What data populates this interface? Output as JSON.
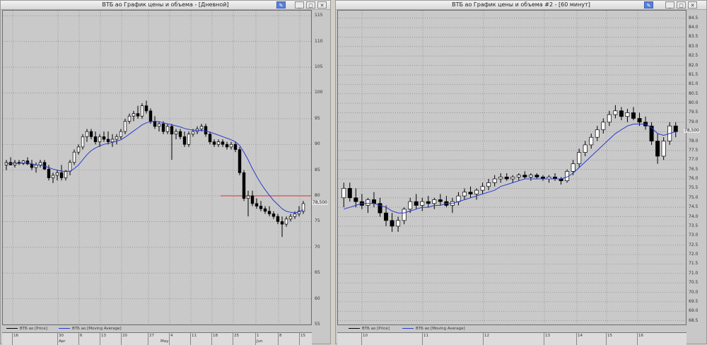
{
  "windows": [
    {
      "title": "ВТБ ао График цены и объема - [Дневной]",
      "buttons": {
        "pin": "✎",
        "minimize": "_",
        "restore": "▢",
        "close": "✕"
      },
      "y_labels": [
        "115",
        "110",
        "105",
        "100",
        "95",
        "90",
        "85",
        "80",
        "75",
        "70",
        "65",
        "60",
        "55"
      ],
      "current_value": "78,500",
      "legend": {
        "price": "ВТБ ао [Price]",
        "ma": "ВТБ ао [Moving Average]"
      },
      "x_days": [
        "16",
        "30",
        "6",
        "13",
        "20",
        "27",
        "4",
        "11",
        "18",
        "25",
        "1",
        "8",
        "15"
      ],
      "x_months": [
        "Apr",
        "May",
        "Jun"
      ],
      "colors": {
        "candle": "#000000",
        "ma": "#2a3bd0",
        "level": "#e03030"
      },
      "chart_data": {
        "type": "candlestick",
        "ylim": [
          55,
          116
        ],
        "level": 80,
        "candles": [
          [
            86,
            87,
            85,
            86.5
          ],
          [
            86.5,
            87.5,
            86,
            86
          ],
          [
            86,
            87,
            85.5,
            86.5
          ],
          [
            86.5,
            87,
            86,
            86.3
          ],
          [
            86.3,
            87,
            86,
            86.8
          ],
          [
            86.8,
            87.5,
            86,
            86.2
          ],
          [
            86.2,
            87,
            85,
            85.5
          ],
          [
            85.5,
            86.5,
            84.5,
            86
          ],
          [
            86,
            87,
            85.5,
            86.5
          ],
          [
            86.5,
            87,
            85,
            85.2
          ],
          [
            85.2,
            86,
            83,
            83.5
          ],
          [
            83.5,
            84.5,
            82.5,
            84
          ],
          [
            84,
            85,
            83,
            84.5
          ],
          [
            84.5,
            86,
            83,
            83.5
          ],
          [
            83.5,
            85,
            83,
            84.8
          ],
          [
            84.8,
            87,
            84,
            86.5
          ],
          [
            86.5,
            89,
            86,
            88.5
          ],
          [
            88.5,
            90,
            88,
            89.5
          ],
          [
            89.5,
            92,
            89,
            91.5
          ],
          [
            91.5,
            93,
            90.5,
            92.5
          ],
          [
            92.5,
            93,
            91,
            91.5
          ],
          [
            91.5,
            92.5,
            90,
            90.5
          ],
          [
            90.5,
            92,
            89.5,
            91.5
          ],
          [
            91.5,
            92.5,
            90.5,
            91
          ],
          [
            91,
            92.5,
            90,
            90.5
          ],
          [
            90.5,
            92,
            89.5,
            91
          ],
          [
            91,
            92,
            90,
            91.5
          ],
          [
            91.5,
            93,
            91,
            92.5
          ],
          [
            92.5,
            95,
            92,
            94.5
          ],
          [
            94.5,
            96,
            94,
            95.5
          ],
          [
            95.5,
            96.5,
            94.5,
            96
          ],
          [
            96,
            97.5,
            95,
            95.5
          ],
          [
            95.5,
            98,
            95,
            97.5
          ],
          [
            97.5,
            98.5,
            96,
            96.5
          ],
          [
            96.5,
            97,
            94,
            94.5
          ],
          [
            94.5,
            95.5,
            93,
            93.5
          ],
          [
            93.5,
            94.5,
            92.5,
            94
          ],
          [
            94,
            94.5,
            92,
            92.5
          ],
          [
            92.5,
            94,
            92,
            93.5
          ],
          [
            93.5,
            94,
            87,
            92
          ],
          [
            92,
            93,
            91,
            92.5
          ],
          [
            92.5,
            93,
            91,
            91.5
          ],
          [
            91.5,
            92.5,
            89.5,
            90
          ],
          [
            90,
            92.5,
            89.5,
            92
          ],
          [
            92,
            93,
            91.5,
            92.5
          ],
          [
            92.5,
            93.5,
            92,
            93
          ],
          [
            93,
            94,
            92.5,
            93.5
          ],
          [
            93.5,
            94,
            91.5,
            92
          ],
          [
            92,
            92.5,
            90,
            90.5
          ],
          [
            90.5,
            91,
            89.5,
            90
          ],
          [
            90,
            91,
            89.5,
            90.5
          ],
          [
            90.5,
            91,
            89.5,
            90
          ],
          [
            90,
            90.5,
            89,
            89.5
          ],
          [
            89.5,
            90.5,
            89,
            90
          ],
          [
            90,
            90.5,
            88.5,
            89
          ],
          [
            89,
            89.5,
            84,
            84.5
          ],
          [
            84.5,
            85,
            79,
            79.5
          ],
          [
            79.5,
            81,
            76,
            80
          ],
          [
            80,
            81,
            78,
            78.5
          ],
          [
            78.5,
            79.5,
            77.5,
            78
          ],
          [
            78,
            79,
            77,
            77.5
          ],
          [
            77.5,
            78,
            76.5,
            77
          ],
          [
            77,
            78,
            76,
            76.5
          ],
          [
            76.5,
            77,
            75.5,
            76
          ],
          [
            76,
            76.5,
            74.5,
            75
          ],
          [
            75,
            76,
            72,
            74.5
          ],
          [
            74.5,
            76,
            74,
            75.5
          ],
          [
            75.5,
            76.5,
            75,
            76
          ],
          [
            76,
            77,
            75.5,
            76.5
          ],
          [
            76.5,
            78,
            76,
            77
          ],
          [
            77,
            79,
            76.5,
            78.5
          ]
        ],
        "ma": [
          86.3,
          86.3,
          86.3,
          86.3,
          86.4,
          86.4,
          86.2,
          86.0,
          86.0,
          85.8,
          85.5,
          85.2,
          85.0,
          84.8,
          84.7,
          84.8,
          85.3,
          86.0,
          87.0,
          88.0,
          88.8,
          89.3,
          89.7,
          90.0,
          90.2,
          90.4,
          90.6,
          90.9,
          91.4,
          92.0,
          92.6,
          93.2,
          93.8,
          94.2,
          94.4,
          94.5,
          94.4,
          94.2,
          94.0,
          93.8,
          93.6,
          93.4,
          93.1,
          92.9,
          92.8,
          92.7,
          92.7,
          92.6,
          92.4,
          92.1,
          91.8,
          91.5,
          91.2,
          90.9,
          90.5,
          89.8,
          88.5,
          87.0,
          85.3,
          83.8,
          82.4,
          81.2,
          80.1,
          79.1,
          78.3,
          77.5,
          77.0,
          76.8,
          76.7,
          76.9,
          77.3
        ]
      }
    },
    {
      "title": "ВТБ ао График цены и объема #2 - [60 минут]",
      "buttons": {
        "pin": "✎",
        "minimize": "_",
        "restore": "▢",
        "close": "✕"
      },
      "y_labels": [
        "84.5",
        "84.0",
        "83.5",
        "83.0",
        "82.5",
        "82.0",
        "81.5",
        "81.0",
        "80.5",
        "80.0",
        "79.5",
        "79.0",
        "78.5",
        "78.0",
        "77.5",
        "77.0",
        "76.5",
        "76.0",
        "75.5",
        "75.0",
        "74.5",
        "74.0",
        "73.5",
        "73.0",
        "72.5",
        "72.0",
        "71.5",
        "71.0",
        "70.5",
        "70.0",
        "69.5",
        "69.0",
        "68.5"
      ],
      "current_value": "78,500",
      "legend": {
        "price": "ВТБ ао [Price]",
        "ma": "ВТБ ао [Moving Average]"
      },
      "x_days": [
        "10",
        "11",
        "12",
        "13",
        "14",
        "15",
        "16"
      ],
      "colors": {
        "candle": "#000000",
        "ma": "#2a3bd0"
      },
      "chart_data": {
        "type": "candlestick",
        "ylim": [
          68.3,
          84.9
        ],
        "candles": [
          [
            75,
            75.8,
            74.5,
            75.5
          ],
          [
            75.5,
            75.8,
            74.8,
            75
          ],
          [
            75,
            75.5,
            74.5,
            74.8
          ],
          [
            74.8,
            75.2,
            74.4,
            74.6
          ],
          [
            74.6,
            75,
            74.2,
            74.9
          ],
          [
            74.9,
            75.3,
            74.5,
            74.7
          ],
          [
            74.7,
            75,
            74,
            74.2
          ],
          [
            74.2,
            74.6,
            73.5,
            73.8
          ],
          [
            73.8,
            74.2,
            73.2,
            73.5
          ],
          [
            73.5,
            74,
            73.2,
            73.8
          ],
          [
            73.8,
            74.5,
            73.6,
            74.4
          ],
          [
            74.4,
            75,
            74.2,
            74.8
          ],
          [
            74.8,
            75.2,
            74.4,
            74.6
          ],
          [
            74.6,
            75,
            74.3,
            74.8
          ],
          [
            74.8,
            75.1,
            74.5,
            74.7
          ],
          [
            74.7,
            75,
            74.4,
            74.9
          ],
          [
            74.9,
            75.2,
            74.6,
            74.8
          ],
          [
            74.8,
            75.1,
            74.5,
            74.6
          ],
          [
            74.6,
            75,
            74.2,
            74.8
          ],
          [
            74.8,
            75.3,
            74.6,
            75.1
          ],
          [
            75.1,
            75.5,
            74.9,
            75.3
          ],
          [
            75.3,
            75.6,
            75,
            75.2
          ],
          [
            75.2,
            75.5,
            74.9,
            75.4
          ],
          [
            75.4,
            75.8,
            75.2,
            75.6
          ],
          [
            75.6,
            76,
            75.4,
            75.8
          ],
          [
            75.8,
            76.2,
            75.6,
            76
          ],
          [
            76,
            76.3,
            75.8,
            76.1
          ],
          [
            76.1,
            76.3,
            75.9,
            76
          ],
          [
            76,
            76.2,
            75.8,
            76.1
          ],
          [
            76.1,
            76.3,
            75.9,
            76.2
          ],
          [
            76.2,
            76.4,
            76,
            76.1
          ],
          [
            76.1,
            76.3,
            75.9,
            76.2
          ],
          [
            76.2,
            76.3,
            76,
            76.1
          ],
          [
            76.1,
            76.2,
            75.9,
            76
          ],
          [
            76,
            76.2,
            75.8,
            76.1
          ],
          [
            76.1,
            76.3,
            75.9,
            76
          ],
          [
            76,
            76.1,
            75.7,
            75.9
          ],
          [
            75.9,
            76.5,
            75.8,
            76.4
          ],
          [
            76.4,
            77,
            76.2,
            76.8
          ],
          [
            76.8,
            77.6,
            76.6,
            77.4
          ],
          [
            77.4,
            78,
            77.2,
            77.8
          ],
          [
            77.8,
            78.4,
            77.6,
            78.2
          ],
          [
            78.2,
            78.8,
            78,
            78.6
          ],
          [
            78.6,
            79.2,
            78.4,
            79
          ],
          [
            79,
            79.6,
            78.8,
            79.4
          ],
          [
            79.4,
            79.9,
            79.2,
            79.6
          ],
          [
            79.6,
            79.8,
            79.1,
            79.3
          ],
          [
            79.3,
            79.7,
            79,
            79.5
          ],
          [
            79.5,
            79.8,
            79.1,
            79.2
          ],
          [
            79.2,
            79.5,
            78.8,
            79
          ],
          [
            79,
            79.3,
            78.6,
            78.8
          ],
          [
            78.8,
            79,
            77.8,
            78
          ],
          [
            78,
            78.4,
            76.8,
            77.2
          ],
          [
            77.2,
            78.2,
            77,
            78
          ],
          [
            78,
            79,
            77.8,
            78.8
          ],
          [
            78.8,
            79,
            78.2,
            78.5
          ]
        ],
        "ma": [
          74.4,
          74.5,
          74.6,
          74.7,
          74.7,
          74.7,
          74.6,
          74.5,
          74.3,
          74.2,
          74.2,
          74.3,
          74.4,
          74.5,
          74.5,
          74.6,
          74.6,
          74.7,
          74.7,
          74.8,
          74.9,
          75.0,
          75.1,
          75.2,
          75.3,
          75.4,
          75.6,
          75.7,
          75.8,
          75.9,
          76.0,
          76.0,
          76.0,
          76.0,
          76.0,
          76.0,
          76.0,
          76.1,
          76.3,
          76.6,
          76.9,
          77.2,
          77.5,
          77.8,
          78.1,
          78.4,
          78.6,
          78.8,
          78.9,
          78.9,
          78.9,
          78.7,
          78.4,
          78.3,
          78.4,
          78.5
        ]
      }
    }
  ]
}
